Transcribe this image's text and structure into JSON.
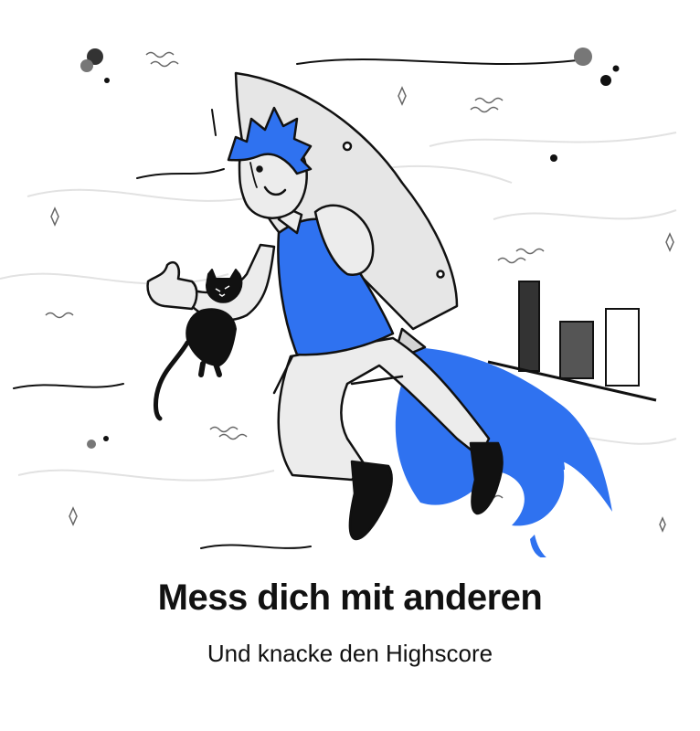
{
  "onboarding": {
    "title": "Mess dich mit anderen",
    "subtitle": "Und knacke den Highscore"
  },
  "illustration": {
    "subject": "person-riding-rocket-holding-cat",
    "accent_color": "#2F72F0",
    "ink_color": "#111111",
    "bar_chart_levels": [
      0.85,
      0.55,
      0.72
    ]
  }
}
